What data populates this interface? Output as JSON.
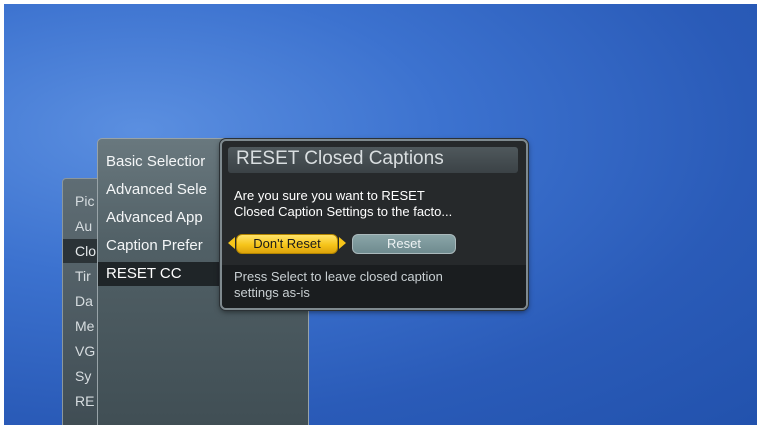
{
  "menu_main": {
    "items": [
      "Pic",
      "Au",
      "Clo",
      "Tir",
      "Da",
      "Me",
      "VG",
      "Sy",
      "RE"
    ]
  },
  "menu_cc": {
    "items": [
      "Basic Selectior",
      "Advanced Sele",
      "Advanced App",
      "Caption Prefer",
      "RESET CC"
    ]
  },
  "dialog": {
    "title": "RESET Closed Captions",
    "message_line1": "Are you sure you want to RESET",
    "message_line2": "Closed Caption Settings to the facto...",
    "buttons": {
      "dont_reset": "Don't Reset",
      "reset": "Reset"
    },
    "help_line1": "Press Select to leave closed caption",
    "help_line2": "settings as-is"
  },
  "colors": {
    "background": "#2a5bb8",
    "highlight": "#f6c51a",
    "panel": "#26292b"
  }
}
